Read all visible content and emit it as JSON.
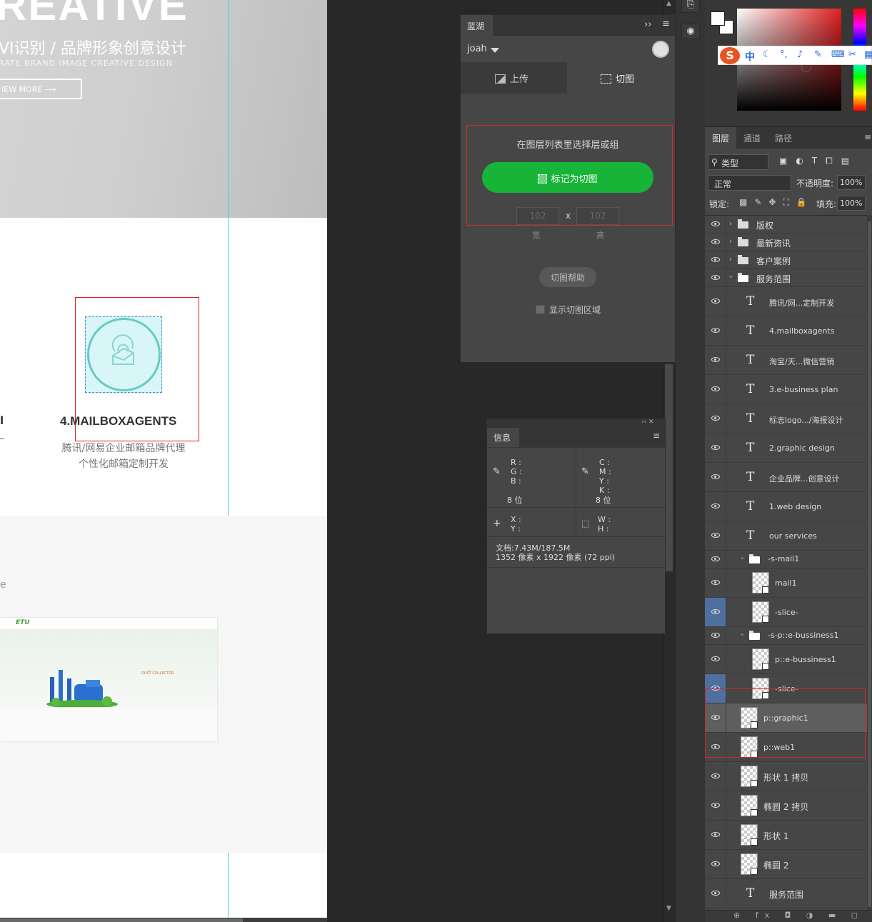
{
  "canvas": {
    "hero": {
      "big_title": "REATIVE",
      "subtitle_cn": "VI识别 / 品牌形象创意设计",
      "subtitle_en": "RATE BRAND IMAGE CREATIVE DESIGN",
      "button_label": "IEW MORE ⟶"
    },
    "service": {
      "left_fragment": "l",
      "title": "4.MAILBOXAGENTS",
      "desc_line1": "腾讯/网易企业邮箱品牌代理",
      "desc_line2": "个性化邮箱定制开发"
    },
    "case": {
      "left_fragment": "e",
      "thumb_logo": "ETU",
      "thumb_caption": "DUST COLLECTOR"
    }
  },
  "lanhu_panel": {
    "tab_title": "蓝湖",
    "collapse_icon": "double-chevron-right-icon",
    "menu_icon": "hamburger-icon",
    "username": "joah",
    "tabs": [
      {
        "label": "上传",
        "icon": "image-icon"
      },
      {
        "label": "切图",
        "icon": "slice-edit-icon"
      }
    ],
    "hint": "在图层列表里选择层或组",
    "mark_button": "标记为切图",
    "width_placeholder": "102",
    "height_placeholder": "102",
    "times": "x",
    "width_label": "宽",
    "height_label": "高",
    "help_button": "切图帮助",
    "show_slice_label": "显示切图区域"
  },
  "info_panel": {
    "header_icons": "‹‹ ✕",
    "tab_title": "信息",
    "rgb_labels": [
      "R :",
      "G :",
      "B :"
    ],
    "cmyk_labels": [
      "C :",
      "M :",
      "Y :",
      "K :"
    ],
    "bit_left": "8 位",
    "bit_right": "8 位",
    "xy_labels": [
      "X :",
      "Y :"
    ],
    "wh_labels": [
      "W :",
      "H :"
    ],
    "doc_line1": "文档:7.43M/187.5M",
    "doc_line2": "1352 像素 x 1922 像素 (72 ppi)"
  },
  "ime": {
    "brand": "S",
    "mode": "中",
    "icons": [
      "moon-icon",
      "punct-icon",
      "mic-icon",
      "pen-icon",
      "keyboard-icon",
      "scissors-icon",
      "grid-icon"
    ]
  },
  "layers_panel": {
    "tabs": [
      "图层",
      "通道",
      "路径"
    ],
    "filter_label": "类型",
    "blend_mode": "正常",
    "opacity_label": "不透明度:",
    "opacity_value": "100%",
    "lock_label": "锁定:",
    "fill_label": "填充:",
    "fill_value": "100%",
    "layers": [
      {
        "name": "版权",
        "type": "group"
      },
      {
        "name": "最新资讯",
        "type": "group"
      },
      {
        "name": "客户案例",
        "type": "group"
      },
      {
        "name": "服务范围",
        "type": "group-open"
      },
      {
        "name": "腾讯/网...定制开发",
        "type": "text"
      },
      {
        "name": "4.mailboxagents",
        "type": "text"
      },
      {
        "name": "淘宝/天...微信营销",
        "type": "text"
      },
      {
        "name": "3.e-business plan",
        "type": "text"
      },
      {
        "name": "标志logo.../海报设计",
        "type": "text"
      },
      {
        "name": "2.graphic design",
        "type": "text"
      },
      {
        "name": "企业品牌...创意设计",
        "type": "text"
      },
      {
        "name": "1.web design",
        "type": "text"
      },
      {
        "name": "our services",
        "type": "text"
      },
      {
        "name": "-s-mail1",
        "type": "subgroup"
      },
      {
        "name": "mail1",
        "type": "smart"
      },
      {
        "name": "-slice-",
        "type": "smart"
      },
      {
        "name": "-s-p::e-bussiness1",
        "type": "subgroup"
      },
      {
        "name": "p::e-bussiness1",
        "type": "smart"
      },
      {
        "name": "-slice-",
        "type": "smart"
      },
      {
        "name": "p::graphic1",
        "type": "smart"
      },
      {
        "name": "p::web1",
        "type": "smart"
      },
      {
        "name": "形状 1 拷贝",
        "type": "shape"
      },
      {
        "name": "椭圆 2 拷贝",
        "type": "shape"
      },
      {
        "name": "形状 1",
        "type": "shape"
      },
      {
        "name": "椭圆 2",
        "type": "shape"
      },
      {
        "name": "服务范围",
        "type": "text"
      }
    ],
    "footer_icons": "⊕ fx ◘ ◑ ▬ ◻ ▭"
  }
}
